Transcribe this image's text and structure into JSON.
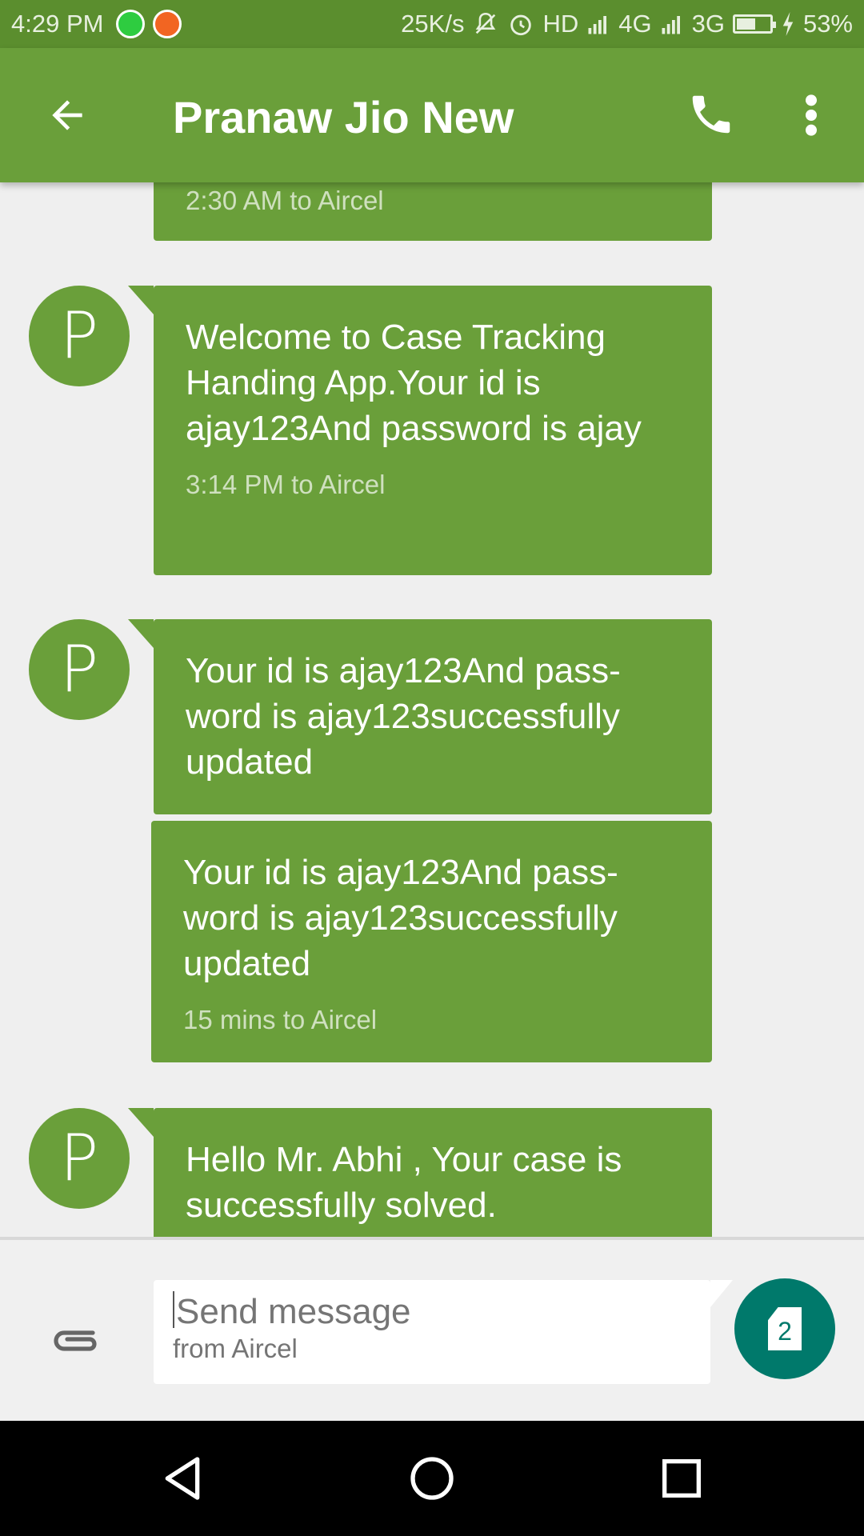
{
  "status_bar": {
    "time": "4:29 PM",
    "speed": "25K/s",
    "hd": "HD",
    "net1": "4G",
    "net2": "3G",
    "battery": "53%",
    "icons": [
      "whatsapp-icon",
      "notification-icon",
      "mute-icon",
      "alarm-icon",
      "signal-icon",
      "battery-icon",
      "charging-icon"
    ]
  },
  "header": {
    "title": "Pranaw Jio New",
    "icons": [
      "back-arrow-icon",
      "phone-icon",
      "more-vert-icon"
    ]
  },
  "messages": [
    {
      "text": "",
      "meta": "2:30 AM to Aircel"
    },
    {
      "avatar": "P",
      "text": "Welcome to Case Tracking Handing App.Your id is ajay123And password is ajay",
      "meta": "3:14 PM to Aircel"
    },
    {
      "avatar": "P",
      "text": "Your id is ajay123And pass-word is ajay123successfully updated",
      "meta": ""
    },
    {
      "text": "Your id is ajay123And pass-word is ajay123successfully updated",
      "meta": "15 mins to Aircel"
    },
    {
      "avatar": "P",
      "text": "Hello Mr. Abhi , Your case is successfully solved.",
      "meta": ""
    }
  ],
  "compose": {
    "placeholder": "Send message",
    "sub": "from Aircel",
    "sim_number": "2",
    "icons": [
      "attach-icon",
      "sim-send-icon"
    ]
  },
  "nav": {
    "icons": [
      "nav-back-icon",
      "nav-home-icon",
      "nav-recents-icon"
    ]
  },
  "colors": {
    "status_bar": "#5b8e2e",
    "app_bar": "#6a9f3a",
    "bubble": "#6a9f3a",
    "send_button": "#00796b"
  }
}
